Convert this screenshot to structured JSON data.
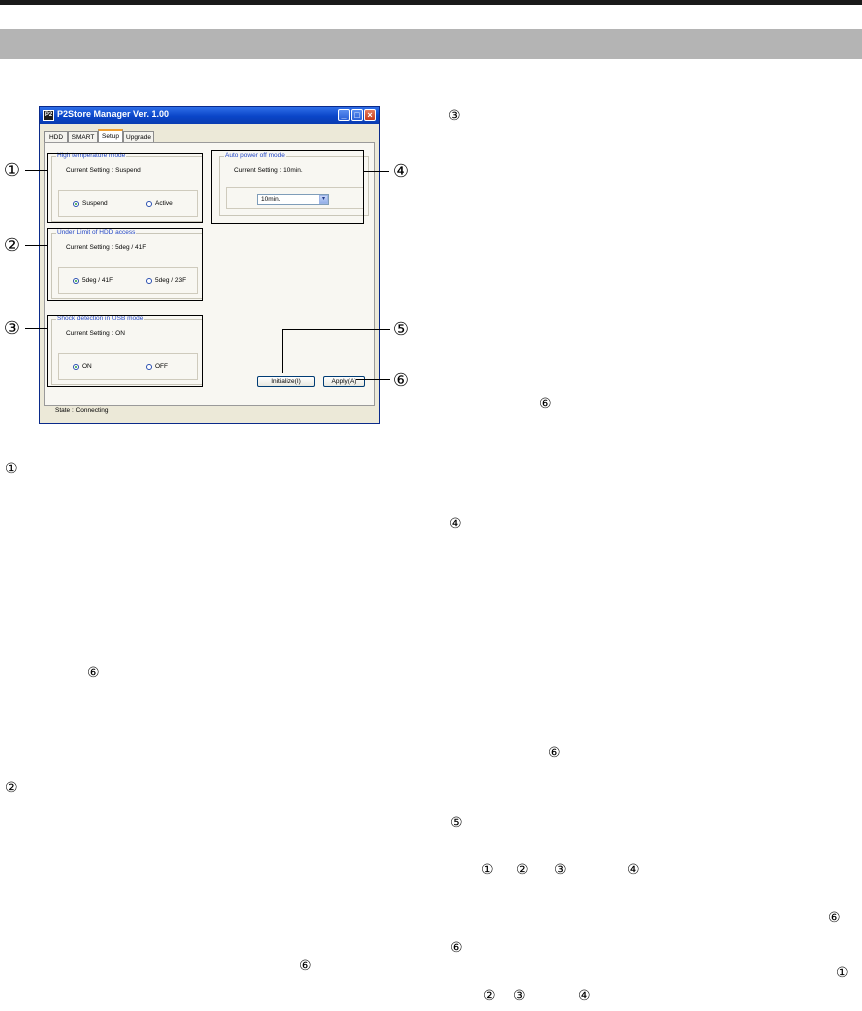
{
  "window": {
    "title": "P2Store Manager   Ver. 1.00",
    "app_icon": "P2",
    "caption_buttons": [
      "_",
      "□",
      "×"
    ],
    "tabs": [
      {
        "label": "HDD"
      },
      {
        "label": "SMART"
      },
      {
        "label": "Setup",
        "selected": true
      },
      {
        "label": "Upgrade"
      }
    ],
    "groups": {
      "high_temp": {
        "title": "High temperature mode",
        "setting": "Current Setting :   Suspend",
        "options": [
          {
            "label": "Suspend",
            "selected": true
          },
          {
            "label": "Active",
            "selected": false
          }
        ]
      },
      "under_limit": {
        "title": "Under Limit of HDD access",
        "setting": "Current Setting :   5deg / 41F",
        "options": [
          {
            "label": "5deg / 41F",
            "selected": true
          },
          {
            "label": "5deg / 23F",
            "selected": false
          }
        ]
      },
      "shock": {
        "title": "Shock detection in USB mode",
        "setting": "Current Setting : ON",
        "options": [
          {
            "label": "ON",
            "selected": true
          },
          {
            "label": "OFF",
            "selected": false
          }
        ]
      },
      "auto_power": {
        "title": "Auto power off mode",
        "setting": "Current Setting :   10min.",
        "dropdown_value": "10min."
      }
    },
    "buttons": {
      "initialize": "Initialize(I)",
      "apply": "Apply(A)"
    },
    "state": "State :   Connecting"
  },
  "callouts": [
    "①",
    "②",
    "③",
    "④",
    "⑤",
    "⑥"
  ],
  "text_marks": {
    "m1": "③",
    "m2": "⑥",
    "m3": "①",
    "m4": "⑥",
    "m5": "④",
    "m6": "⑥",
    "m7": "②",
    "m8": "⑤",
    "m9": [
      "①",
      "②",
      "③",
      "④"
    ],
    "m10": "⑥",
    "m11": "⑥",
    "m12": "⑥",
    "m13": "①",
    "m14": [
      "②",
      "③",
      "④"
    ]
  },
  "colors": {
    "title_bar": "#0a45c8",
    "group_title": "#2347c6",
    "header_band": "#b4b4b4"
  }
}
